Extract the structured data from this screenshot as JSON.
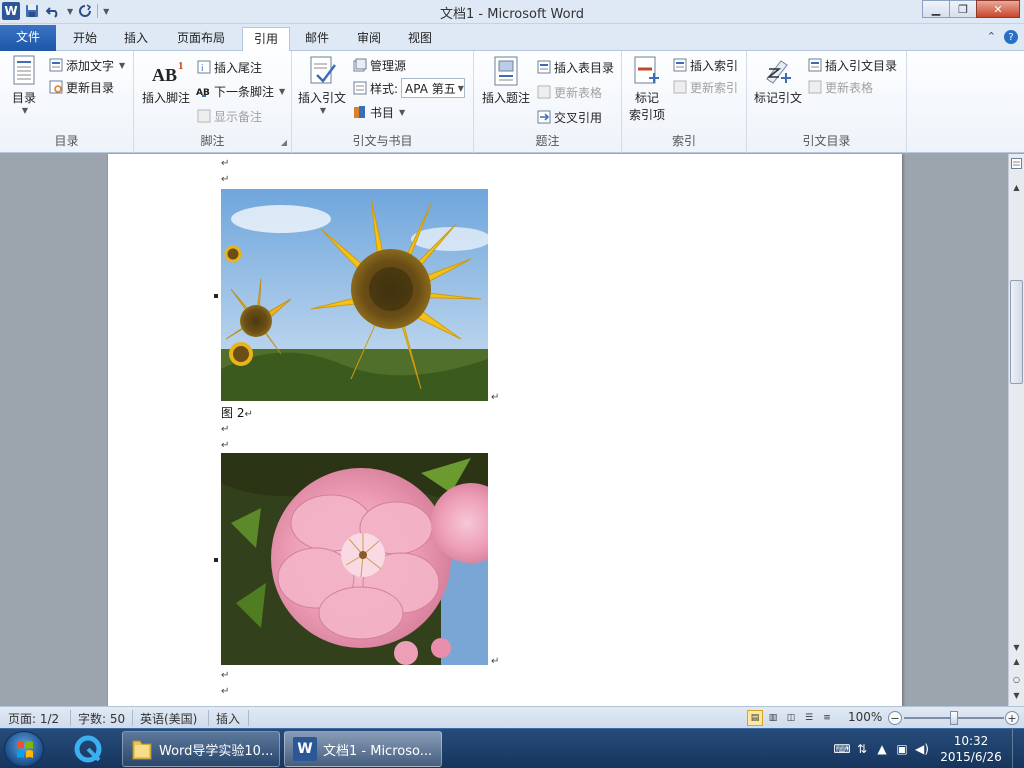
{
  "window": {
    "title": "文档1 - Microsoft Word",
    "logo_letter": "W"
  },
  "tabs": [
    {
      "label": "文件"
    },
    {
      "label": "开始"
    },
    {
      "label": "插入"
    },
    {
      "label": "页面布局"
    },
    {
      "label": "引用"
    },
    {
      "label": "邮件"
    },
    {
      "label": "审阅"
    },
    {
      "label": "视图"
    }
  ],
  "ribbon": {
    "toc": {
      "label": "目录",
      "toc_button": "目录",
      "add_text": "添加文字",
      "update_toc": "更新目录"
    },
    "footnotes": {
      "label": "脚注",
      "insert_footnote": "插入脚注",
      "insert_endnote": "插入尾注",
      "next_footnote": "下一条脚注",
      "show_notes": "显示备注"
    },
    "citations": {
      "label": "引文与书目",
      "insert_citation": "插入引文",
      "manage_sources": "管理源",
      "style_label": "样式:",
      "style_value": "APA 第五",
      "bibliography": "书目"
    },
    "captions": {
      "label": "题注",
      "insert_caption": "插入题注",
      "insert_table_of_figures": "插入表目录",
      "update_table": "更新表格",
      "cross_reference": "交叉引用"
    },
    "index": {
      "label": "索引",
      "mark_entry_line1": "标记",
      "mark_entry_line2": "索引项",
      "insert_index": "插入索引",
      "update_index": "更新索引"
    },
    "toa": {
      "label": "引文目录",
      "mark_citation": "标记引文",
      "insert_toa": "插入引文目录",
      "update_table": "更新表格"
    }
  },
  "document": {
    "caption": "图 2",
    "paragraph_mark": "↵",
    "images": [
      {
        "name": "sunflower"
      },
      {
        "name": "pink-flower"
      }
    ]
  },
  "statusbar": {
    "page": "页面: 1/2",
    "words": "字数: 50",
    "language": "英语(美国)",
    "mode": "插入",
    "zoom": "100%",
    "zoom_level": 100
  },
  "taskbar": {
    "items": [
      {
        "label": "Word导学实验10..."
      },
      {
        "label": "文档1 - Microso..."
      }
    ],
    "time": "10:32",
    "date": "2015/6/26"
  },
  "colors": {
    "file_tab": "#2b5797",
    "accent": "#2a4f86",
    "close": "#c7472d"
  },
  "icons": [
    "word-logo-icon",
    "save-icon",
    "undo-icon",
    "redo-icon",
    "customize-icon",
    "minimize-icon",
    "restore-icon",
    "close-icon",
    "help-icon"
  ]
}
